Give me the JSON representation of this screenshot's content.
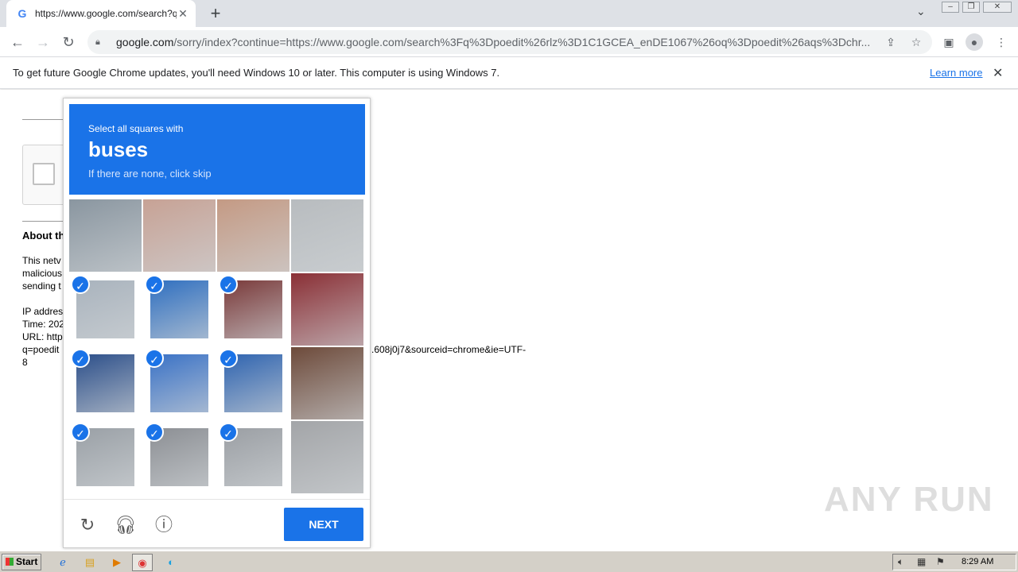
{
  "browser": {
    "tab_title": "https://www.google.com/search?q=",
    "tab_favicon": "G",
    "url_host": "google.com",
    "url_rest": "/sorry/index?continue=https://www.google.com/search%3Fq%3Dpoedit%26rlz%3D1C1GCEA_enDE1067%26oq%3Dpoedit%26aqs%3Dchr...",
    "infobar_message": "To get future Google Chrome updates, you'll need Windows 10 or later. This computer is using Windows 7.",
    "infobar_link": "Learn more"
  },
  "page": {
    "about_heading": "About th",
    "para_lines": [
      "This netv",
      "malicious",
      "sending t"
    ],
    "ip_line": "IP addres",
    "time_line": "Time: 202",
    "url_line": "URL: http",
    "q_line": "q=poedit",
    "eight": "8",
    "url_fragment": ".608j0j7&sourceid=chrome&ie=UTF-"
  },
  "captcha": {
    "instruction_small": "Select all squares with",
    "target": "buses",
    "hint": "If there are none, click skip",
    "next_label": "NEXT",
    "selected_flags": [
      false,
      false,
      false,
      false,
      true,
      true,
      true,
      false,
      true,
      true,
      true,
      false,
      true,
      true,
      true,
      false
    ],
    "tile_colors": [
      "#8a96a0",
      "#c7a295",
      "#c49a84",
      "#b8bcbf",
      "#a9b3bd",
      "#2f6fc0",
      "#7a3a3a",
      "#8a2f35",
      "#2c4f8a",
      "#3a72c6",
      "#2f64b0",
      "#6d4a3a",
      "#9aa0a6",
      "#8c8f94",
      "#9b9fa4",
      "#a3a5a8"
    ]
  },
  "taskbar": {
    "start_label": "Start",
    "clock": "8:29 AM"
  },
  "watermark": "ANY RUN"
}
